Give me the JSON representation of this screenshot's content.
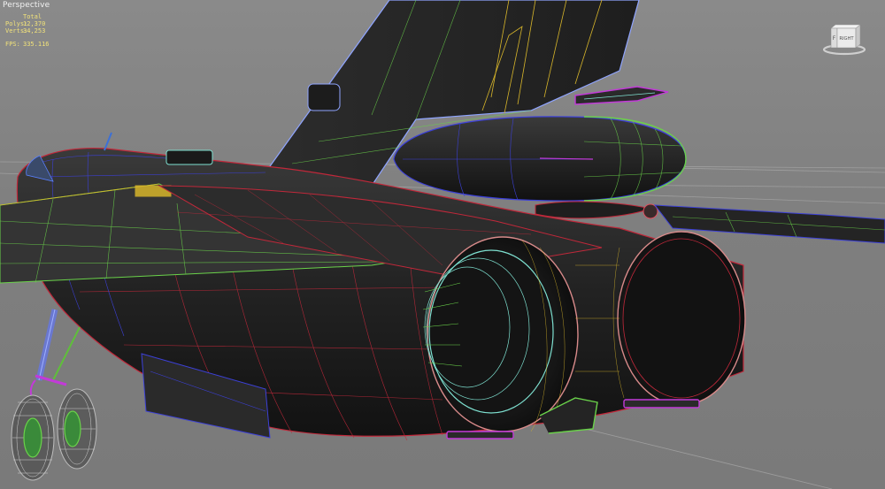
{
  "viewport": {
    "label": "Perspective"
  },
  "stats": {
    "header": "Total",
    "polys_label": "Polys:",
    "polys_value": "12,370",
    "verts_label": "Verts:",
    "verts_value": "34,253",
    "fps_label": "FPS:",
    "fps_value": "335.116"
  },
  "viewcube": {
    "left_face": "F",
    "front_face": "RIGHT"
  },
  "colors": {
    "background": "#7d7d7d",
    "overlay_text": "#f2f2f2",
    "stats_text": "#f1e27a",
    "mesh_dark": "#2a2a2a",
    "wire_red": "#c0283a",
    "wire_green": "#6ad24a",
    "wire_blue": "#3c40d8",
    "wire_yellow": "#d7b52a",
    "wire_cyan": "#7ee0d0",
    "wire_magenta": "#c23ad8"
  }
}
